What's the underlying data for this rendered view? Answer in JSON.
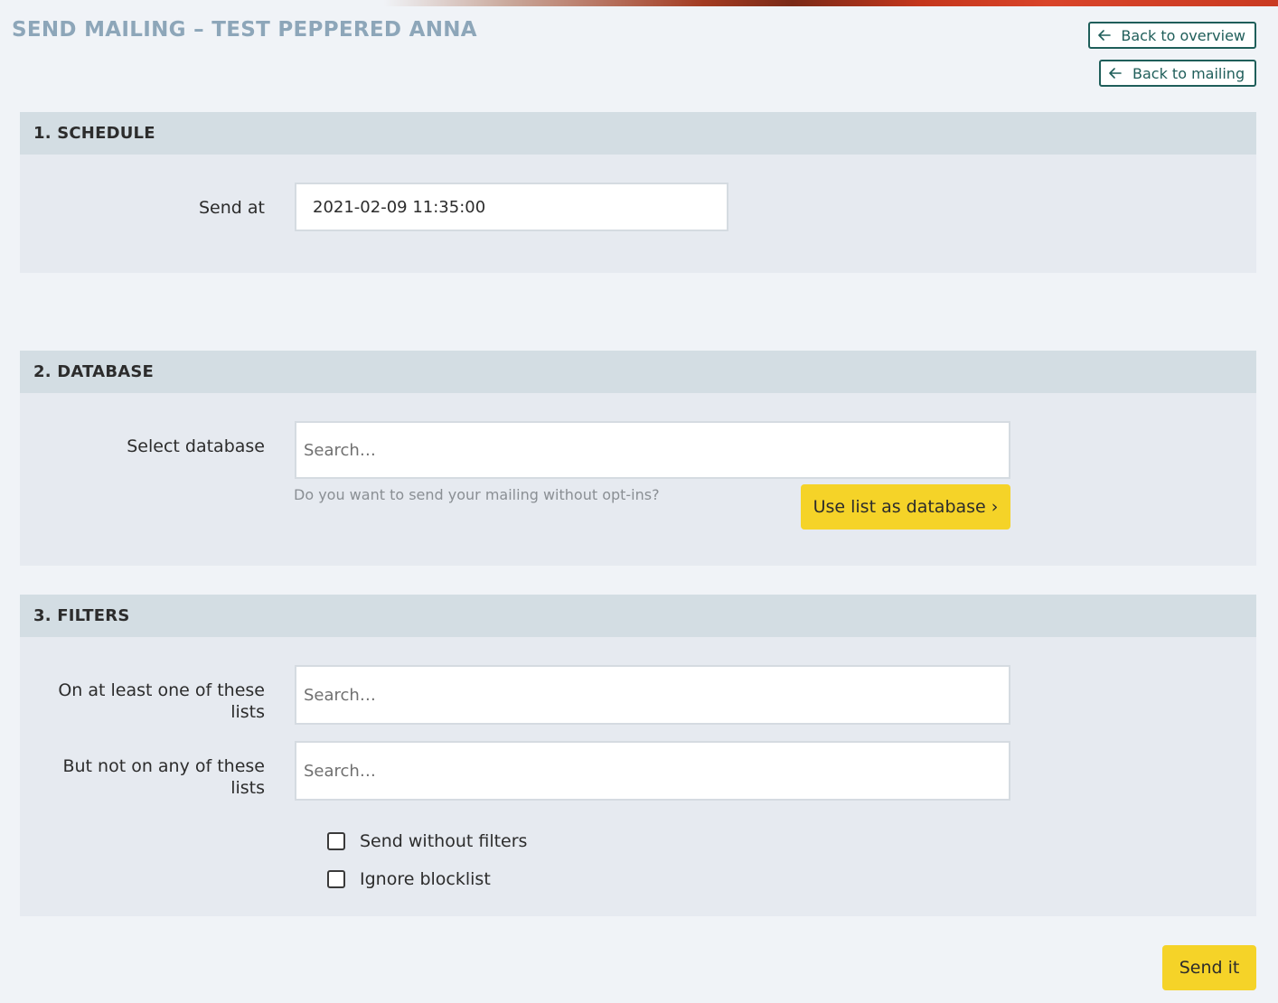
{
  "page": {
    "title": "SEND MAILING – TEST PEPPERED ANNA"
  },
  "nav": {
    "back_overview": "Back to overview",
    "back_mailing": "Back to mailing"
  },
  "schedule": {
    "heading": "1. SCHEDULE",
    "send_at_label": "Send at",
    "send_at_value": "2021-02-09 11:35:00"
  },
  "database": {
    "heading": "2. DATABASE",
    "select_label": "Select database",
    "search_placeholder": "Search…",
    "hint": "Do you want to send your mailing without opt-ins?",
    "use_list_button": "Use list as database ›"
  },
  "filters": {
    "heading": "3. FILTERS",
    "include_label": "On at least one of these lists",
    "include_placeholder": "Search…",
    "exclude_label": "But not on any of these lists",
    "exclude_placeholder": "Search…",
    "send_without_filters": "Send without filters",
    "ignore_blocklist": "Ignore blocklist"
  },
  "actions": {
    "send_button": "Send it"
  },
  "colors": {
    "accent_yellow": "#f5d328",
    "nav_teal": "#1f5e5a",
    "title_blue_gray": "#8da6b9"
  },
  "icons": {
    "back": "arrow-left-icon"
  }
}
